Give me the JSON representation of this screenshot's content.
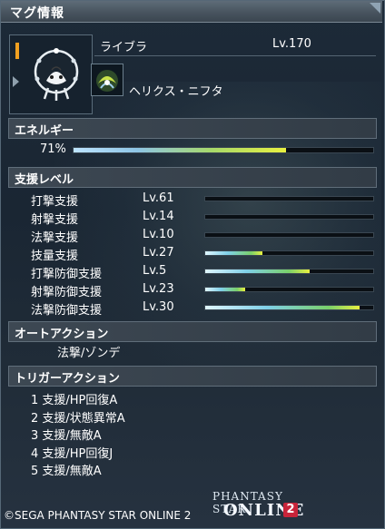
{
  "window": {
    "title": "マグ情報"
  },
  "mag": {
    "name": "ライブラ",
    "level": "Lv.170"
  },
  "photon_blast": {
    "name": "ヘリクス・ニフタ"
  },
  "energy": {
    "header": "エネルギー",
    "percent_label": "71%",
    "fraction": 0.71
  },
  "support_levels": {
    "header": "支援レベル",
    "items": [
      {
        "name": "打撃支援",
        "level": "Lv.61",
        "fill": 0.0
      },
      {
        "name": "射撃支援",
        "level": "Lv.14",
        "fill": 0.0
      },
      {
        "name": "法撃支援",
        "level": "Lv.10",
        "fill": 0.0
      },
      {
        "name": "技量支援",
        "level": "Lv.27",
        "fill": 0.34
      },
      {
        "name": "打撃防御支援",
        "level": "Lv.5",
        "fill": 0.62
      },
      {
        "name": "射撃防御支援",
        "level": "Lv.23",
        "fill": 0.24
      },
      {
        "name": "法撃防御支援",
        "level": "Lv.30",
        "fill": 0.92
      }
    ]
  },
  "auto_action": {
    "header": "オートアクション",
    "value": "法撃/ゾンデ"
  },
  "trigger_action": {
    "header": "トリガーアクション",
    "items": [
      "1 支援/HP回復A",
      "2 支援/状態異常A",
      "3 支援/無敵A",
      "4 支援/HP回復J",
      "5 支援/無敵A"
    ]
  },
  "footer": {
    "copyright": "©SEGA PHANTASY STAR ONLINE 2",
    "logo_line1": "PHANTASY STAR",
    "logo_line2": "ONLINE",
    "logo_number": "2"
  },
  "colors": {
    "title_bar": "#5e6c78",
    "bar_track": "#0a0f14",
    "bar_end": "#e8f040",
    "logo_badge": "#c8243a"
  },
  "icons": {
    "mag": "mag-creature-icon",
    "photon_blast": "helix-nifta-icon",
    "select_arrow": "arrow-right-icon"
  }
}
